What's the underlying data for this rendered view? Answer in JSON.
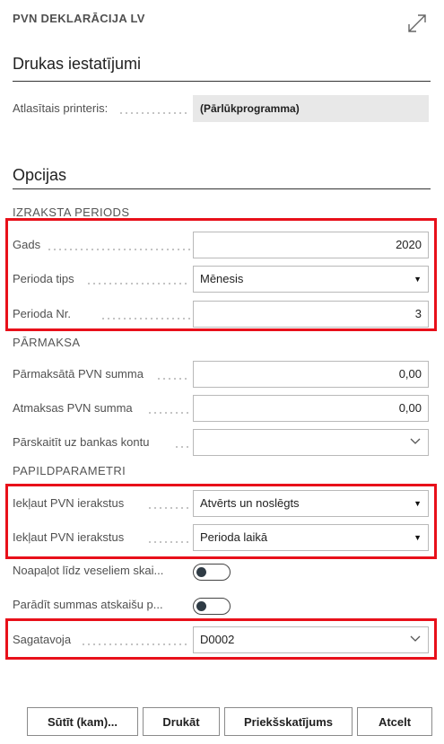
{
  "header": {
    "title": "PVN DEKLARĀCIJA LV"
  },
  "print_settings": {
    "title": "Drukas iestatījumi",
    "printer_label": "Atlasītais printeris:",
    "printer_value": "(Pārlūkprogramma)"
  },
  "options": {
    "title": "Opcijas",
    "period_group": {
      "title": "IZRAKSTA PERIODS",
      "year_label": "Gads",
      "year_value": "2020",
      "period_type_label": "Perioda tips",
      "period_type_value": "Mēnesis",
      "period_no_label": "Perioda Nr.",
      "period_no_value": "3"
    },
    "overpayment_group": {
      "title": "PĀRMAKSA",
      "overpaid_label": "Pārmaksātā PVN summa",
      "overpaid_value": "0,00",
      "refund_label": "Atmaksas PVN summa",
      "refund_value": "0,00",
      "transfer_label": "Pārskaitīt uz bankas kontu",
      "transfer_value": ""
    },
    "extra_group": {
      "title": "PAPILDPARAMETRI",
      "include_entries_1_label": "Iekļaut PVN ierakstus",
      "include_entries_1_value": "Atvērts un noslēgts",
      "include_entries_2_label": "Iekļaut PVN ierakstus",
      "include_entries_2_value": "Perioda laikā",
      "round_label": "Noapaļot līdz veseliem skai...",
      "show_amounts_label": "Parādīt summas atskaišu p...",
      "round_on": false,
      "show_amounts_on": false
    },
    "prepared_by_label": "Sagatavoja",
    "prepared_by_value": "D0002"
  },
  "buttons": {
    "send": "Sūtīt (kam)...",
    "print": "Drukāt",
    "preview": "Priekšskatījums",
    "cancel": "Atcelt"
  },
  "colors": {
    "highlight": "#e8101a"
  }
}
